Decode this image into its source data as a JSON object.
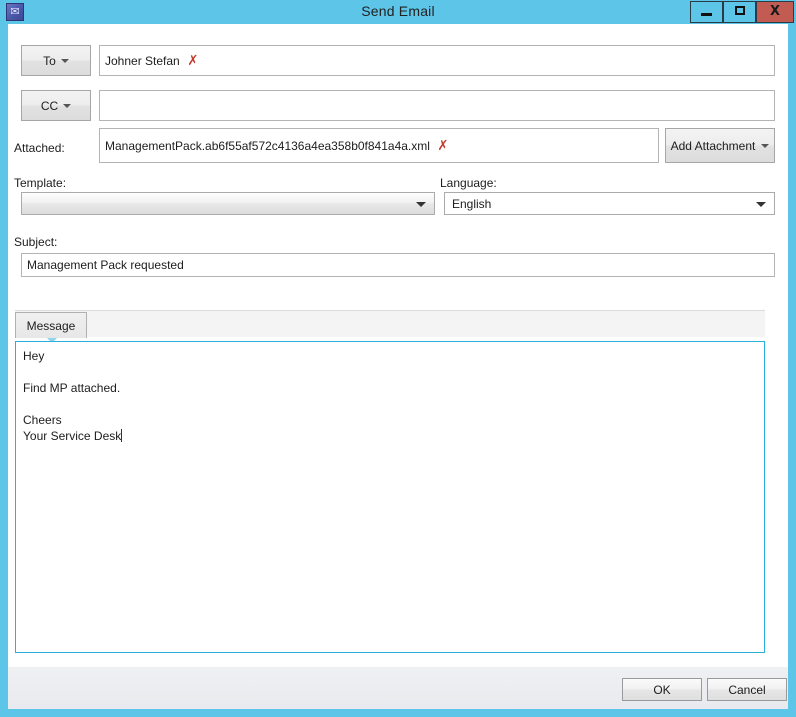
{
  "window": {
    "title": "Send Email",
    "icon": "envelope-app-icon",
    "controls": {
      "minimize": "minimize-icon",
      "maximize": "maximize-icon",
      "close": "X"
    },
    "frame_color": "#5dc6e8",
    "close_color": "#c25b52"
  },
  "recipients": {
    "to": {
      "button_label": "To",
      "value": "Johner Stefan",
      "remove_icon": "✗"
    },
    "cc": {
      "button_label": "CC",
      "value": ""
    }
  },
  "attachment": {
    "label": "Attached:",
    "filename": "ManagementPack.ab6f55af572c4136a4ea358b0f841a4a.xml",
    "remove_icon": "✗",
    "add_button_label": "Add Attachment"
  },
  "template": {
    "label": "Template:",
    "value": ""
  },
  "language": {
    "label": "Language:",
    "value": "English"
  },
  "subject": {
    "label": "Subject:",
    "value": "Management Pack requested"
  },
  "tabs": [
    {
      "label": "Message"
    }
  ],
  "message": {
    "body": "Hey\n\nFind MP attached.\n\nCheers\nYour Service Desk"
  },
  "footer": {
    "ok_label": "OK",
    "cancel_label": "Cancel"
  }
}
